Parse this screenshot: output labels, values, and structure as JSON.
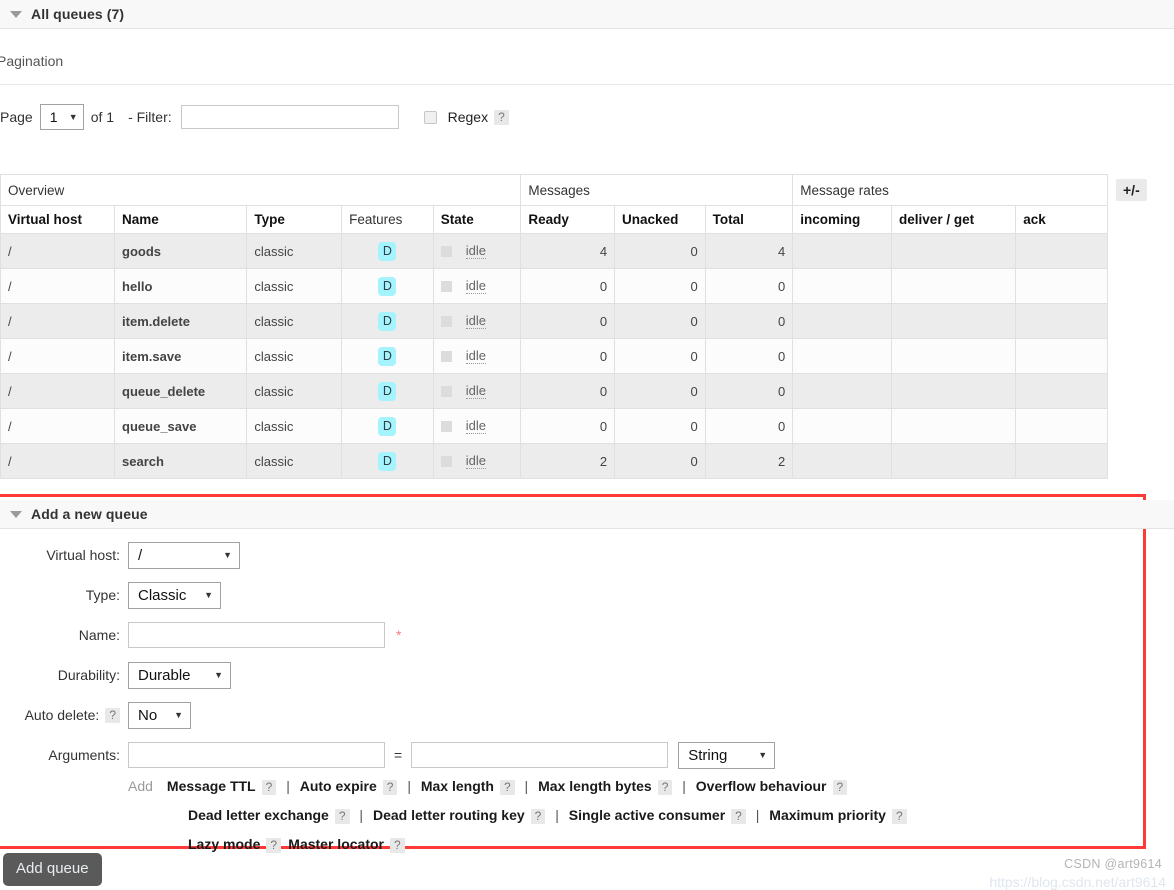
{
  "queues_section": {
    "title": "All queues (7)",
    "caret_icon": "caret-down-icon"
  },
  "pagination": {
    "label": "Pagination",
    "page_word": "Page",
    "page_value": "1",
    "of_text": "of 1",
    "filter_label": "- Filter:",
    "filter_value": "",
    "filter_placeholder": "",
    "regex_label": "Regex",
    "regex_help": "?",
    "regex_checked": false
  },
  "table": {
    "group_headers": [
      {
        "label": "Overview",
        "span": 5
      },
      {
        "label": "Messages",
        "span": 3
      },
      {
        "label": "Message rates",
        "span": 3
      }
    ],
    "columns": [
      "Virtual host",
      "Name",
      "Type",
      "Features",
      "State",
      "Ready",
      "Unacked",
      "Total",
      "incoming",
      "deliver / get",
      "ack"
    ],
    "toggle_columns_label": "+/-",
    "rows": [
      {
        "vhost": "/",
        "name": "goods",
        "type": "classic",
        "feature": "D",
        "state": "idle",
        "ready": "4",
        "unacked": "0",
        "total": "4",
        "incoming": "",
        "deliver_get": "",
        "ack": ""
      },
      {
        "vhost": "/",
        "name": "hello",
        "type": "classic",
        "feature": "D",
        "state": "idle",
        "ready": "0",
        "unacked": "0",
        "total": "0",
        "incoming": "",
        "deliver_get": "",
        "ack": ""
      },
      {
        "vhost": "/",
        "name": "item.delete",
        "type": "classic",
        "feature": "D",
        "state": "idle",
        "ready": "0",
        "unacked": "0",
        "total": "0",
        "incoming": "",
        "deliver_get": "",
        "ack": ""
      },
      {
        "vhost": "/",
        "name": "item.save",
        "type": "classic",
        "feature": "D",
        "state": "idle",
        "ready": "0",
        "unacked": "0",
        "total": "0",
        "incoming": "",
        "deliver_get": "",
        "ack": ""
      },
      {
        "vhost": "/",
        "name": "queue_delete",
        "type": "classic",
        "feature": "D",
        "state": "idle",
        "ready": "0",
        "unacked": "0",
        "total": "0",
        "incoming": "",
        "deliver_get": "",
        "ack": ""
      },
      {
        "vhost": "/",
        "name": "queue_save",
        "type": "classic",
        "feature": "D",
        "state": "idle",
        "ready": "0",
        "unacked": "0",
        "total": "0",
        "incoming": "",
        "deliver_get": "",
        "ack": ""
      },
      {
        "vhost": "/",
        "name": "search",
        "type": "classic",
        "feature": "D",
        "state": "idle",
        "ready": "2",
        "unacked": "0",
        "total": "2",
        "incoming": "",
        "deliver_get": "",
        "ack": ""
      }
    ]
  },
  "add_queue": {
    "title": "Add a new queue",
    "caret_icon": "caret-down-icon",
    "fields": {
      "virtual_host_label": "Virtual host:",
      "virtual_host_value": "/",
      "type_label": "Type:",
      "type_value": "Classic",
      "name_label": "Name:",
      "name_value": "",
      "name_required_mark": "*",
      "durability_label": "Durability:",
      "durability_value": "Durable",
      "auto_delete_label": "Auto delete:",
      "auto_delete_help": "?",
      "auto_delete_value": "No",
      "arguments_label": "Arguments:",
      "argument_key_value": "",
      "equals_sign": "=",
      "argument_val_value": "",
      "argument_type_value": "String"
    },
    "add_word": "Add",
    "argument_presets": [
      {
        "label": "Message TTL",
        "help": "?",
        "sep": "|"
      },
      {
        "label": "Auto expire",
        "help": "?",
        "sep": "|"
      },
      {
        "label": "Max length",
        "help": "?",
        "sep": "|"
      },
      {
        "label": "Max length bytes",
        "help": "?",
        "sep": "|"
      },
      {
        "label": "Overflow behaviour",
        "help": "?",
        "sep": ""
      },
      {
        "label": "Dead letter exchange",
        "help": "?",
        "sep": "|"
      },
      {
        "label": "Dead letter routing key",
        "help": "?",
        "sep": "|"
      },
      {
        "label": "Single active consumer",
        "help": "?",
        "sep": "|"
      },
      {
        "label": "Maximum priority",
        "help": "?",
        "sep": ""
      },
      {
        "label": "Lazy mode",
        "help": "?",
        "sep": ""
      },
      {
        "label": "Master locator",
        "help": "?",
        "sep": ""
      }
    ],
    "submit_label": "Add queue"
  },
  "watermark": {
    "text": "CSDN @art9614",
    "url": "https://blog.csdn.net/art9614"
  },
  "colors": {
    "highlight_border": "#fd3a37",
    "feature_badge_bg": "#a5f3fd",
    "row_odd_bg": "#ececec",
    "row_even_bg": "#fcfcfc",
    "section_head_bg": "#f8f8f8",
    "submit_bg": "#5a5a5a"
  }
}
